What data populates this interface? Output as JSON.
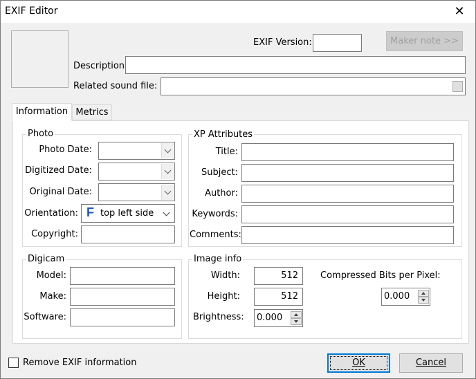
{
  "window": {
    "title": "EXIF Editor",
    "close_symbol": "✕"
  },
  "header": {
    "exif_version_label": "EXIF Version:",
    "exif_version_value": "",
    "maker_note_button": "Maker note >>",
    "description_label": "Description:",
    "description_value": "",
    "related_sound_label": "Related sound file:",
    "related_sound_value": ""
  },
  "tabs": [
    {
      "label": "Information",
      "active": true
    },
    {
      "label": "Metrics",
      "active": false
    }
  ],
  "photo": {
    "group_title": "Photo",
    "photo_date_label": "Photo Date:",
    "digitized_date_label": "Digitized Date:",
    "original_date_label": "Original Date:",
    "orientation_label": "Orientation:",
    "orientation_glyph": "F",
    "orientation_value": "top left side",
    "copyright_label": "Copyright:",
    "copyright_value": ""
  },
  "xp": {
    "group_title": "XP Attributes",
    "title_label": "Title:",
    "subject_label": "Subject:",
    "author_label": "Author:",
    "keywords_label": "Keywords:",
    "comments_label": "Comments:"
  },
  "digicam": {
    "group_title": "Digicam",
    "model_label": "Model:",
    "make_label": "Make:",
    "software_label": "Software:"
  },
  "image_info": {
    "group_title": "Image info",
    "width_label": "Width:",
    "width_value": "512",
    "height_label": "Height:",
    "height_value": "512",
    "brightness_label": "Brightness:",
    "brightness_value": "0.000",
    "compressed_label": "Compressed Bits per Pixel:",
    "compressed_value": "0.000"
  },
  "footer": {
    "remove_exif_label": "Remove EXIF information",
    "remove_exif_checked": false,
    "ok_label": "OK",
    "cancel_label": "Cancel"
  },
  "colors": {
    "accent": "#0078d7",
    "orientation_glyph": "#1a56c4"
  }
}
